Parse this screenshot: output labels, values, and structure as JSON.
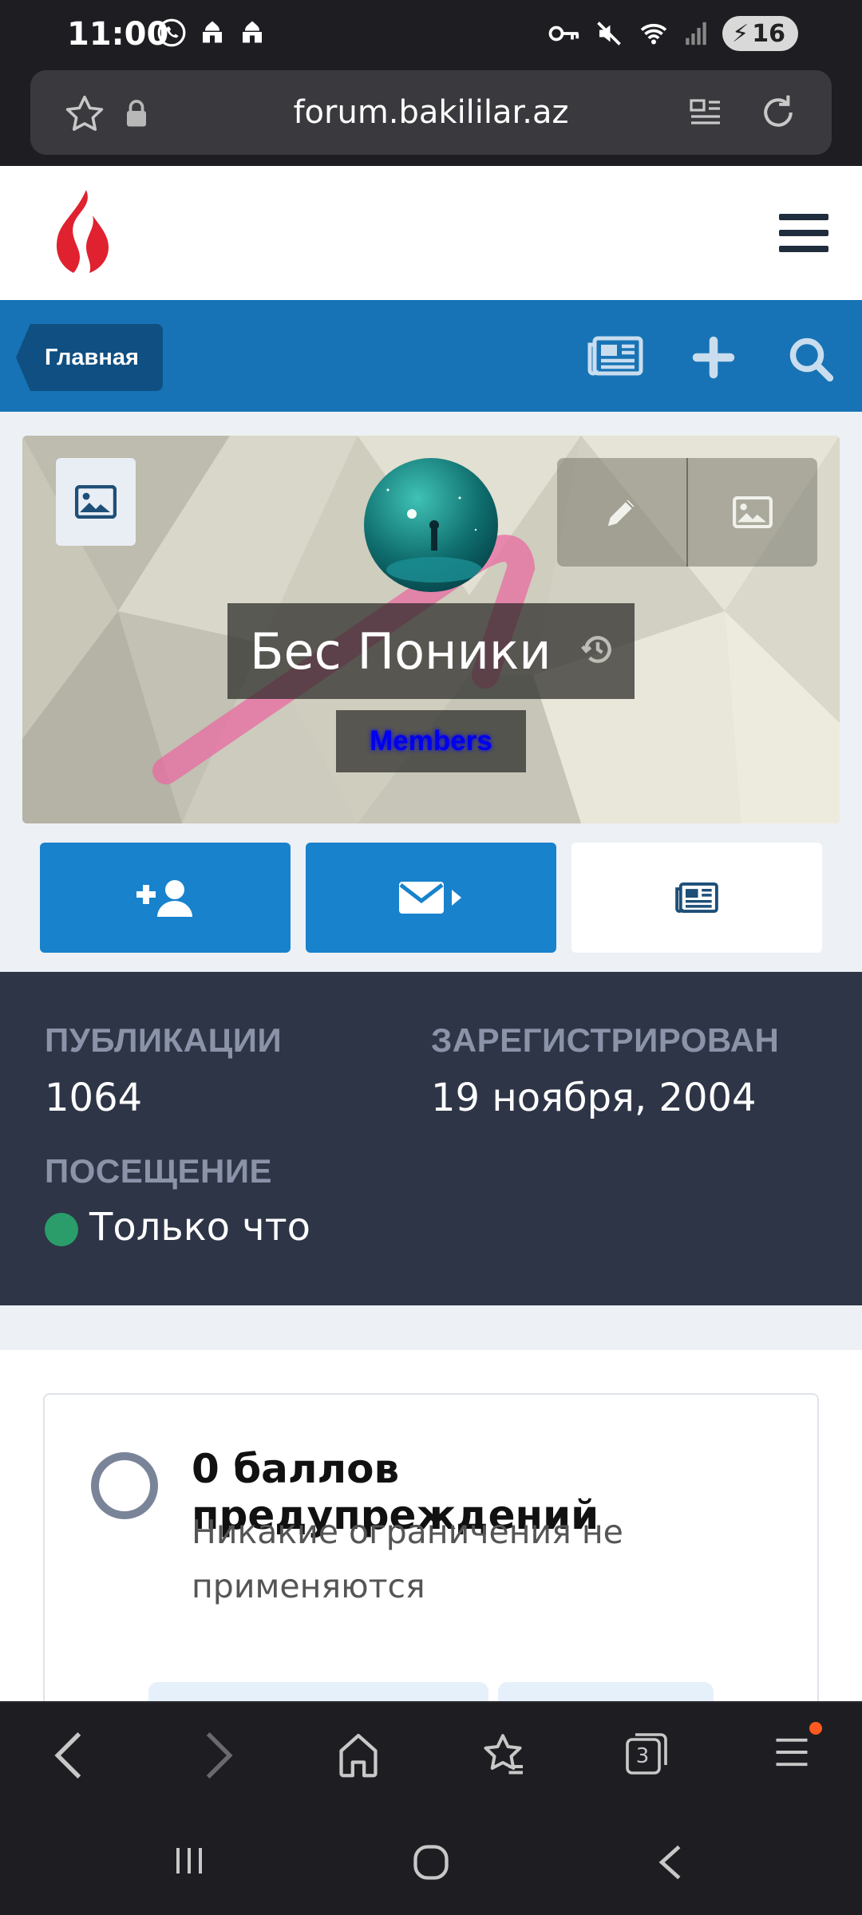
{
  "status_bar": {
    "time": "11:00",
    "battery": "16",
    "left_icons": [
      "whatsapp-icon",
      "mosque-icon",
      "mosque-icon"
    ],
    "right_icons": [
      "key-icon",
      "mute-icon",
      "wifi-icon",
      "signal-icon"
    ]
  },
  "browser": {
    "url": "forum.bakililar.az",
    "tabs_count": "3"
  },
  "nav": {
    "breadcrumb": "Главная"
  },
  "profile": {
    "name": "Бес Поники",
    "group": "Members"
  },
  "stats": {
    "posts_label": "ПУБЛИКАЦИИ",
    "posts_value": "1064",
    "joined_label": "ЗАРЕГИСТРИРОВАН",
    "joined_value": "19 ноября, 2004",
    "visit_label": "ПОСЕЩЕНИЕ",
    "visit_value": "Только что"
  },
  "warnings": {
    "title": "0 баллов предупреждений",
    "description": "Никакие ограничения не применяются"
  },
  "colors": {
    "nav_blue": "#1773b5",
    "breadcrumb_blue": "#0f4f82",
    "action_blue": "#1882cc",
    "stats_bg": "#2e3547",
    "online_green": "#2a9d6a",
    "group_color": "#0000ee",
    "logo_red": "#e0212f"
  }
}
